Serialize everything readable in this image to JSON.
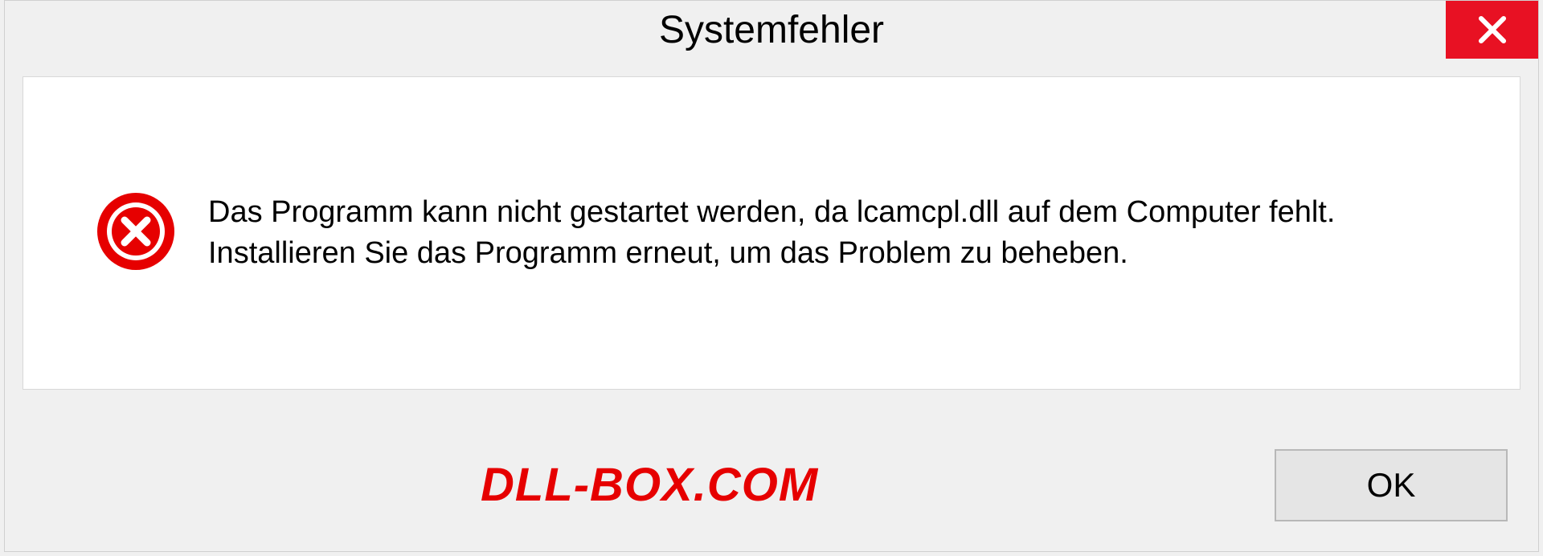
{
  "dialog": {
    "title": "Systemfehler",
    "message": "Das Programm kann nicht gestartet werden, da lcamcpl.dll auf dem Computer fehlt. Installieren Sie das Programm erneut, um das Problem zu beheben.",
    "ok_label": "OK"
  },
  "watermark": "DLL-BOX.COM"
}
